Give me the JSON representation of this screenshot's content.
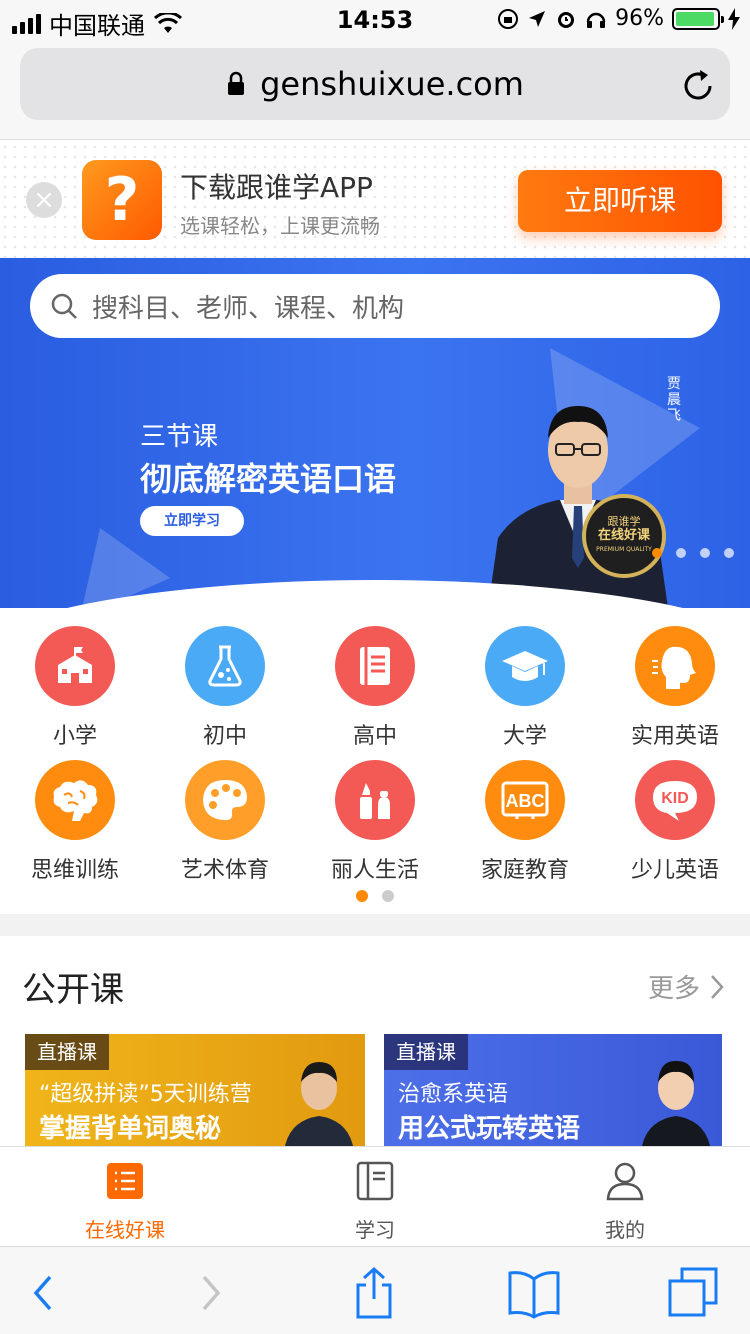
{
  "status_bar": {
    "carrier": "中国联通",
    "time": "14:53",
    "battery": "96%",
    "battery_level": 0.96
  },
  "browser": {
    "url": "genshuixue.com"
  },
  "app_banner": {
    "title": "下载跟谁学APP",
    "subtitle": "选课轻松，上课更流畅",
    "button": "立即听课"
  },
  "hero": {
    "search_placeholder": "搜科目、老师、课程、机构",
    "subtitle": "三节课",
    "title": "彻底解密英语口语",
    "cta": "立即学习",
    "teacher_name": "贾晨飞",
    "seal_line1": "跟谁学",
    "seal_line2": "在线好课",
    "seal_line3": "PREMIUM QUALITY"
  },
  "categories": [
    {
      "label": "小学",
      "color": "#f35a55",
      "icon": "school-icon"
    },
    {
      "label": "初中",
      "color": "#4aaaf5",
      "icon": "flask-icon"
    },
    {
      "label": "高中",
      "color": "#f35a55",
      "icon": "book-icon"
    },
    {
      "label": "大学",
      "color": "#4aaaf5",
      "icon": "graduation-cap-icon"
    },
    {
      "label": "实用英语",
      "color": "#ff8c0f",
      "icon": "speaking-head-icon"
    },
    {
      "label": "思维训练",
      "color": "#ff8c0f",
      "icon": "brain-icon"
    },
    {
      "label": "艺术体育",
      "color": "#ff9f2a",
      "icon": "palette-icon"
    },
    {
      "label": "丽人生活",
      "color": "#f35a55",
      "icon": "lipstick-icon"
    },
    {
      "label": "家庭教育",
      "color": "#ff8c0f",
      "icon": "abc-board-icon"
    },
    {
      "label": "少儿英语",
      "color": "#f35a55",
      "icon": "kid-bubble-icon"
    }
  ],
  "category_icon_text": {
    "abc": "ABC",
    "kid": "KID"
  },
  "open_courses": {
    "title": "公开课",
    "more": "更多",
    "cards": [
      {
        "tag": "直播课",
        "line1": "“超级拼读”5天训练营",
        "line2": "掌握背单词奥秘",
        "color": "#f0b51a"
      },
      {
        "tag": "直播课",
        "line1": "治愈系英语",
        "line2": "用公式玩转英语",
        "color": "#4d6fe8"
      }
    ]
  },
  "tabbar": {
    "tabs": [
      {
        "label": "在线好课",
        "active": true
      },
      {
        "label": "学习",
        "active": false
      },
      {
        "label": "我的",
        "active": false
      }
    ]
  },
  "colors": {
    "accent": "#ff6a00",
    "hero_blue": "#2a5de0",
    "ios_blue": "#1a7cf5"
  }
}
